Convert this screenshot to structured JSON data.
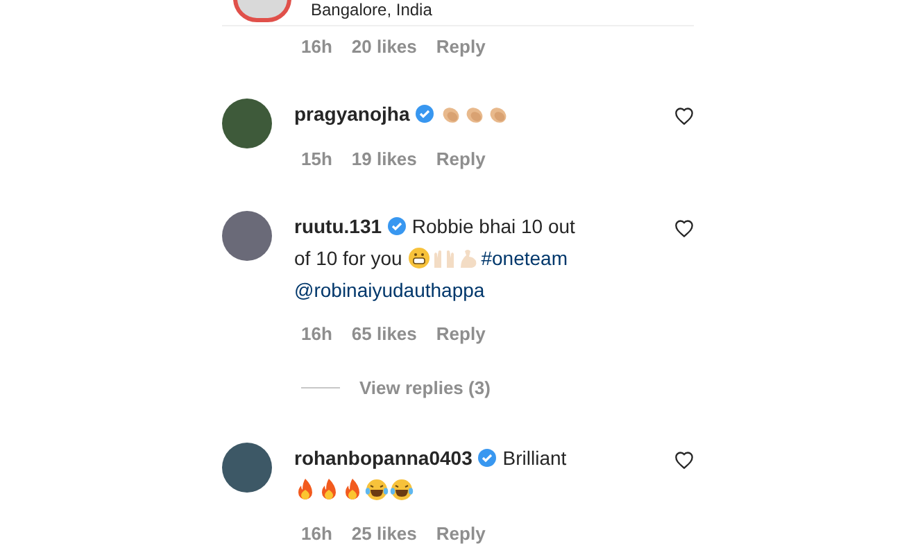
{
  "top_comment": {
    "location": "Bangalore, India",
    "time": "16h",
    "likes": "20 likes",
    "reply": "Reply"
  },
  "comments": [
    {
      "username": "pragyanojha",
      "verified": true,
      "liked": false,
      "segments": [
        {
          "kind": "clap"
        },
        {
          "kind": "clap"
        },
        {
          "kind": "clap"
        }
      ],
      "time": "15h",
      "likes": "19 likes",
      "reply": "Reply"
    },
    {
      "username": "ruutu.131",
      "verified": true,
      "liked": false,
      "segments": [
        {
          "kind": "text",
          "text": "Robbie bhai 10 out"
        },
        {
          "kind": "text",
          "text": "of 10 for you"
        },
        {
          "kind": "grin"
        },
        {
          "kind": "hands"
        },
        {
          "kind": "muscle"
        },
        {
          "kind": "tag",
          "text": "#oneteam"
        },
        {
          "kind": "tag",
          "text": "@robinaiyudauthappa"
        }
      ],
      "time": "16h",
      "likes": "65 likes",
      "reply": "Reply",
      "view_replies": "View replies (3)"
    },
    {
      "username": "rohanbopanna0403",
      "verified": true,
      "liked": false,
      "segments": [
        {
          "kind": "text",
          "text": "Brilliant"
        },
        {
          "kind": "break"
        },
        {
          "kind": "fire"
        },
        {
          "kind": "fire"
        },
        {
          "kind": "fire"
        },
        {
          "kind": "laugh"
        },
        {
          "kind": "laugh"
        }
      ],
      "time": "16h",
      "likes": "25 likes",
      "reply": "Reply"
    }
  ]
}
